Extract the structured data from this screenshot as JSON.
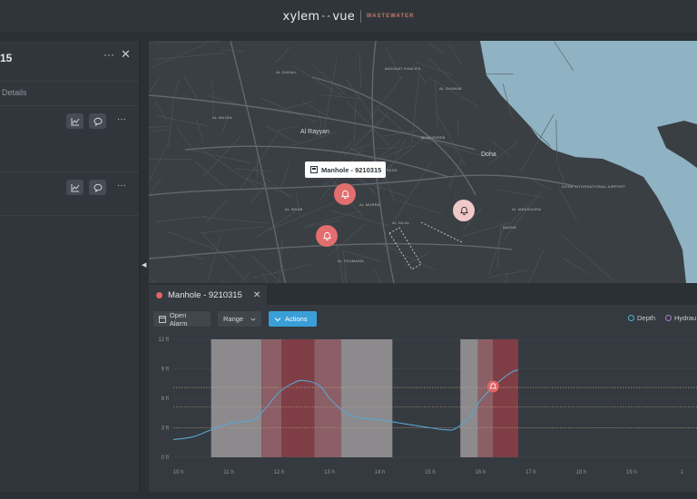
{
  "app": {
    "brand": "xylem",
    "brand_mark": "vue",
    "brand_sub": "WASTEWATER"
  },
  "left_panel": {
    "title_fragment": "15",
    "tab_details": "Details",
    "more_icon": "ellipsis-icon",
    "close_icon": "close-icon"
  },
  "map": {
    "labels": [
      {
        "text": "Al Rayyan",
        "big": true
      },
      {
        "text": "Doha",
        "big": true
      },
      {
        "text": "AL MAJDA"
      },
      {
        "text": "AL SADD"
      },
      {
        "text": "AL HILAL"
      },
      {
        "text": "MUSHEIREB"
      },
      {
        "text": "AL WAAB"
      },
      {
        "text": "AL MURRA"
      },
      {
        "text": "AL DUHAIL"
      },
      {
        "text": "MADINAT KHALIFA"
      },
      {
        "text": "AL MANSOURA"
      },
      {
        "text": "AL THUMAMA"
      },
      {
        "text": "DOHA INTERNATIONAL AIRPORT"
      },
      {
        "text": "AL GHANIM"
      },
      {
        "text": "NAJMA"
      }
    ],
    "tooltip": "Manhole - 9210315",
    "pins": [
      {
        "color": "#e26e6e",
        "icon": "bell-icon"
      },
      {
        "color": "#e26e6e",
        "icon": "bell-icon"
      },
      {
        "color": "#f1c8c8",
        "icon": "bell-icon"
      }
    ]
  },
  "tabs": [
    {
      "label": "Manhole - 9210315",
      "status_color": "#e06464"
    }
  ],
  "toolbar": {
    "open_alarm": "Open Alarm",
    "range": "Range",
    "actions": "Actions"
  },
  "legend": [
    {
      "label": "Depth",
      "color": "#4fb6d6"
    },
    {
      "label": "Hydrau",
      "color": "#b27ac8"
    }
  ],
  "chart_data": {
    "type": "line",
    "x_ticks": [
      "10 h",
      "11 h",
      "12 h",
      "13 h",
      "14 h",
      "15 h",
      "16 h",
      "17 h",
      "18 h",
      "19 h",
      "1"
    ],
    "y_ticks": [
      "0 ft",
      "3 ft",
      "6 ft",
      "9 ft",
      "12 ft"
    ],
    "ylim": [
      0,
      12
    ],
    "xlim": [
      9.9,
      20.3
    ],
    "series": [
      {
        "name": "Depth",
        "color": "#5aa6d4",
        "x": [
          9.9,
          10.3,
          10.7,
          11.0,
          11.2,
          11.5,
          11.7,
          12.0,
          12.3,
          12.5,
          12.8,
          13.0,
          13.3,
          13.6,
          14.0,
          14.5,
          15.0,
          15.3,
          15.5,
          15.8,
          16.0,
          16.3,
          16.6,
          16.75
        ],
        "values": [
          1.8,
          2.1,
          2.9,
          3.4,
          3.6,
          3.8,
          4.8,
          6.6,
          7.6,
          7.8,
          7.3,
          6.0,
          4.6,
          4.0,
          3.8,
          3.4,
          3.0,
          2.8,
          2.9,
          4.2,
          5.8,
          7.4,
          8.6,
          8.9
        ]
      }
    ],
    "threshold_lines": [
      7.1,
      5.1,
      3.0
    ],
    "alarm_bands": [
      {
        "start": 10.65,
        "end": 11.65,
        "level": "low"
      },
      {
        "start": 11.65,
        "end": 12.05,
        "level": "medium"
      },
      {
        "start": 12.05,
        "end": 12.7,
        "level": "high"
      },
      {
        "start": 12.7,
        "end": 13.23,
        "level": "medium"
      },
      {
        "start": 13.23,
        "end": 14.25,
        "level": "low"
      },
      {
        "start": 15.6,
        "end": 15.95,
        "level": "low"
      },
      {
        "start": 15.95,
        "end": 16.25,
        "level": "medium"
      },
      {
        "start": 16.25,
        "end": 16.75,
        "level": "high"
      }
    ],
    "alarm_marker": {
      "x": 16.25,
      "y": 7.2,
      "icon": "bell-icon"
    }
  },
  "colors": {
    "band_low": "#8c8a8d",
    "band_medium": "#8b5f65",
    "band_high": "#7f3e46",
    "accent": "#3a9fd8",
    "alarm": "#e06464"
  }
}
